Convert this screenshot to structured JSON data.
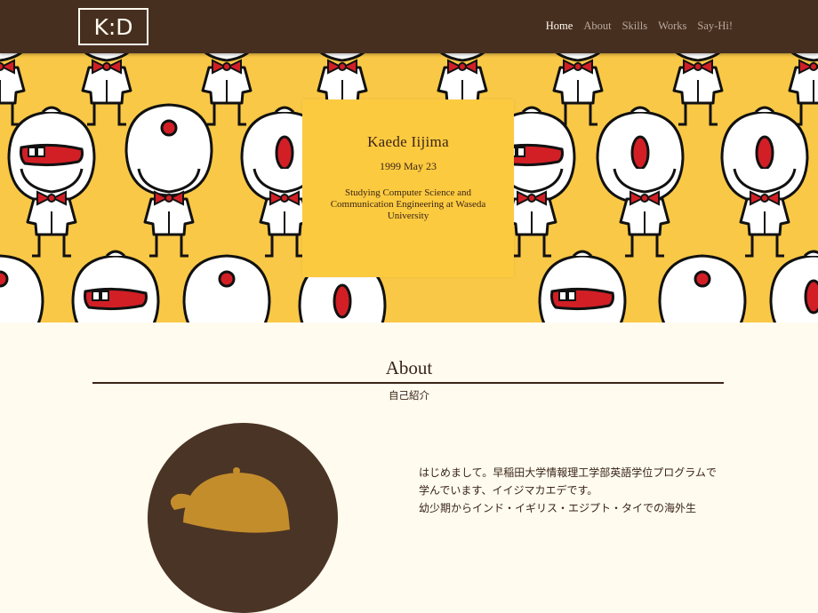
{
  "header": {
    "logo": "K:D",
    "nav": [
      {
        "label": "Home",
        "active": true
      },
      {
        "label": "About",
        "active": false
      },
      {
        "label": "Skills",
        "active": false
      },
      {
        "label": "Works",
        "active": false
      },
      {
        "label": "Say-Hi!",
        "active": false
      }
    ]
  },
  "hero": {
    "name": "Kaede Iijima",
    "birthdate": "1999 May 23",
    "description": "Studying Computer Science and Communication Engineering at Waseda University"
  },
  "about": {
    "title": "About",
    "subtitle": "自己紹介",
    "paragraphs": [
      "はじめまして。早稲田大学情報理工学部英語学位プログラムで学んでいます、イイジマカエデです。",
      "幼少期からインド・イギリス・エジプト・タイでの海外生"
    ]
  },
  "colors": {
    "header_bg": "#472f20",
    "hero_bg": "#f9c846",
    "card_bg": "#fcca3f",
    "page_bg": "#fffbef",
    "accent_red": "#d21f26",
    "text_dark": "#3a2418",
    "cap": "#c48d2c"
  }
}
